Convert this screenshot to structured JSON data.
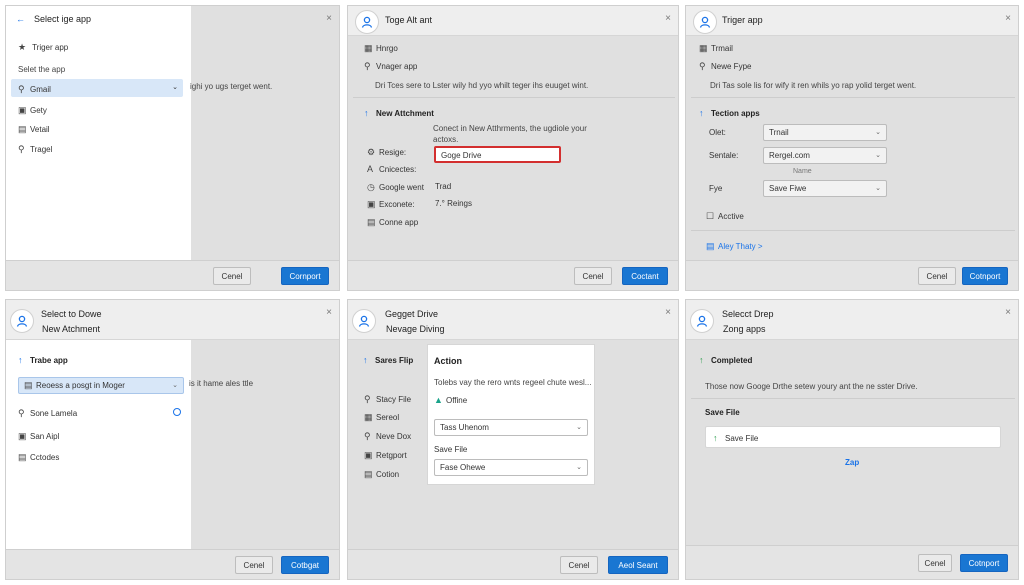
{
  "panel1": {
    "title": "Select ige app",
    "heading": "Triger app",
    "subheading": "Selet the app",
    "items": [
      "Gmail",
      "Gety",
      "Vetail",
      "Tragel"
    ],
    "helper": "ighi yo ugs terget went.",
    "cancel": "Cenel",
    "confirm": "Cornport"
  },
  "panel2": {
    "title": "Toge Alt ant",
    "top_items": [
      "Hnrgo",
      "Vnager app"
    ],
    "description": "Dri Tces sere to Lster wily hd yyo whilt teger ihs euuget wint.",
    "section": "New Attchment",
    "section_desc": "Conect in New Atthrments, the ugdiole your actoxs.",
    "rows": [
      {
        "label": "Resige:",
        "value": "Goge Drive"
      },
      {
        "label": "Cnicectes:",
        "value": ""
      },
      {
        "label": "Google went",
        "value": "Trad"
      },
      {
        "label": "Exconete:",
        "value": "7.° Reings"
      },
      {
        "label": "Conne app",
        "value": ""
      }
    ],
    "cancel": "Cenel",
    "confirm": "Coctant"
  },
  "panel3": {
    "title": "Triger app",
    "top_items": [
      "Trmail",
      "Newe Fype"
    ],
    "description": "Dri Tas sole lis for wify it ren whils yo rap yolid terget went.",
    "section": "Tection apps",
    "fields": [
      {
        "label": "Olet:",
        "value": "Trnail",
        "hint": ""
      },
      {
        "label": "Sentale:",
        "value": "Rergel.com",
        "hint": "Name"
      },
      {
        "label": "Fye",
        "value": "Save Fiwe",
        "hint": ""
      }
    ],
    "checkbox": "Acctive",
    "link": "Aley Thaty >",
    "cancel": "Cenel",
    "confirm": "Cotnport"
  },
  "panel4": {
    "title": "Select to Dowe",
    "subtitle": "New Atchment",
    "heading": "Trabe app",
    "dropdown": "Reoess a posgt in Moger",
    "helper": "is it hame ales ttle",
    "items": [
      "Sone Lamela",
      "San Aipl",
      "Cctodes"
    ],
    "cancel": "Cenel",
    "confirm": "Cotbgat"
  },
  "panel5": {
    "title": "Gegget Drive",
    "subtitle": "Nevage Diving",
    "side_header": "Sares Flip",
    "side_items": [
      "Stacy File",
      "Sereol",
      "Neve Dox",
      "Retgport",
      "Cotion"
    ],
    "card_title": "Action",
    "card_desc": "Tolebs vay the rero wnts regeel chute wesl...",
    "status": "Offine",
    "field1": "Tass Uhenom",
    "field2_label": "Save File",
    "field2": "Fase Ohewe",
    "cancel": "Cenel",
    "confirm": "Aeol Seant"
  },
  "panel6": {
    "title": "Selecct Drep",
    "subtitle": "Zong apps",
    "heading": "Completed",
    "description": "Those now Googe Drthe setew youry ant the ne sster Drive.",
    "section": "Save File",
    "card": "Save File",
    "link": "Zap",
    "cancel": "Cenel",
    "confirm": "Cotnport"
  },
  "colors": {
    "accent": "#1976d2",
    "highlight": "#d8e7f8",
    "error": "#d32f2f",
    "success": "#2e9e4f",
    "teal": "#1aa38a"
  }
}
